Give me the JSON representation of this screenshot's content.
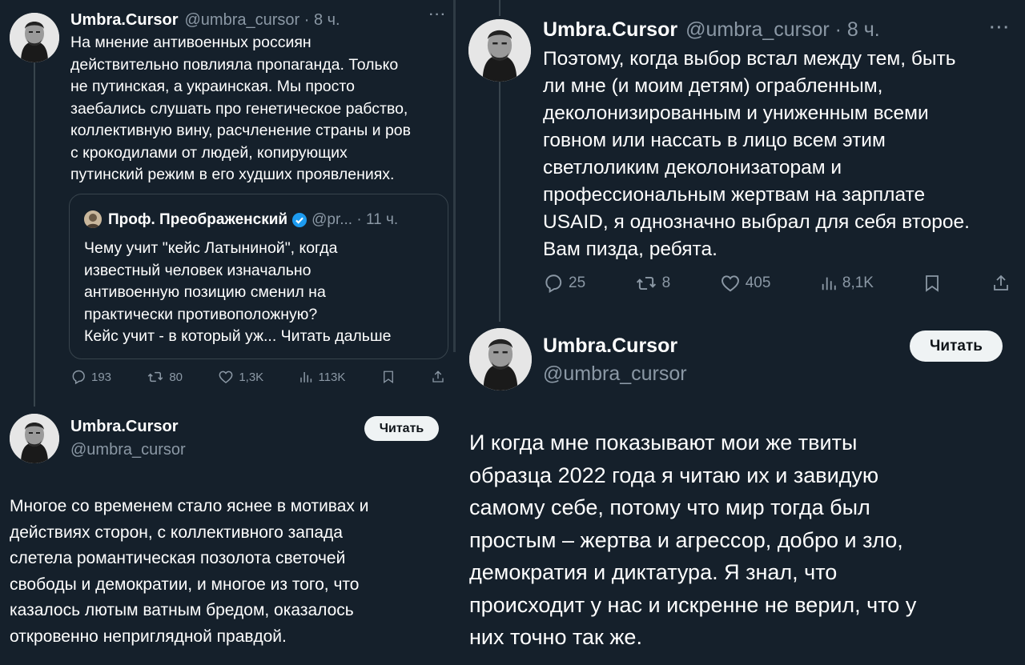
{
  "left_top_tweet": {
    "author_name": "Umbra.Cursor",
    "handle_time": "@umbra_cursor · 8 ч.",
    "more": "···",
    "lines": [
      "На мнение антивоенных россиян",
      "действительно  повлияла пропаганда. Только",
      "не путинская, а украинская. Мы просто",
      "заебались слушать про генетическое рабство,",
      "коллективную вину, расчленение страны и ров",
      "с крокодилами от людей, копирующих",
      "путинский режим в его худших проявлениях."
    ],
    "quote": {
      "author_name": "Проф. Преображенский",
      "handle_time": "@pr... · 11 ч.",
      "lines": [
        "Чему учит \"кейс Латыниной\", когда",
        "известный человек изначально",
        "антивоенную позицию сменил на",
        "практически противоположную?",
        "Кейс учит - в который уж... Читать дальше"
      ]
    },
    "stats": {
      "replies": "193",
      "reposts": "80",
      "likes": "1,3K",
      "views": "113K"
    }
  },
  "left_bottom_tweet": {
    "author_name": "Umbra.Cursor",
    "handle": "@umbra_cursor",
    "follow_label": "Читать",
    "lines": [
      "Многое со временем стало яснее в мотивах и",
      "действиях сторон, с коллективного запада",
      "слетела романтическая позолота светочей",
      "свободы и демократии, и многое из того, что",
      "казалось лютым ватным бредом, оказалось",
      "откровенно неприглядной правдой."
    ]
  },
  "right_top_tweet": {
    "author_name": "Umbra.Cursor",
    "handle_time": "@umbra_cursor · 8 ч.",
    "more": "···",
    "lines": [
      "Поэтому, когда выбор встал между тем, быть",
      "ли мне (и моим детям) ограбленным,",
      "деколонизированным и униженным всеми",
      "говном или нассать в лицо всем этим",
      "светлоликим деколонизаторам и",
      "профессиональным жертвам на зарплате",
      "USAID, я однозначно выбрал для себя второе.",
      "Вам пизда, ребята."
    ],
    "stats": {
      "replies": "25",
      "reposts": "8",
      "likes": "405",
      "views": "8,1K"
    }
  },
  "right_bottom_tweet": {
    "author_name": "Umbra.Cursor",
    "handle": "@umbra_cursor",
    "follow_label": "Читать",
    "lines": [
      "И когда мне показывают мои же твиты",
      "образца 2022 года я читаю их и завидую",
      "самому себе, потому что мир тогда был",
      "простым – жертва и агрессор, добро и зло,",
      "демократия и диктатура. Я знал, что",
      "происходит у нас и искренне не верил, что у",
      "них точно так же."
    ]
  },
  "colors": {
    "background": "#15202b",
    "text": "#ffffff",
    "secondary": "#8b98a5",
    "border": "#38444d",
    "verified": "#1d9bf0",
    "button_bg": "#eff3f4"
  }
}
